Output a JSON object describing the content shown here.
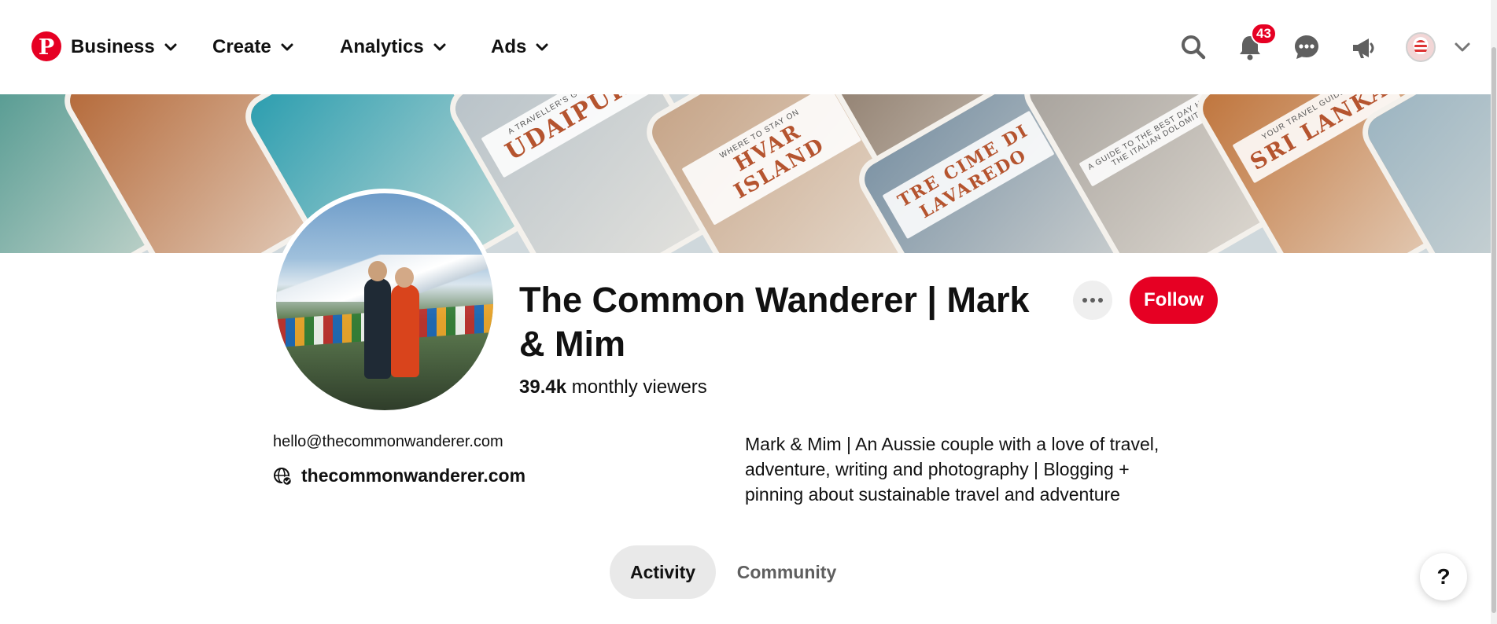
{
  "nav": {
    "logo_letter": "P",
    "business": "Business",
    "create": "Create",
    "analytics": "Analytics",
    "ads": "Ads",
    "notifications_count": "43"
  },
  "cover": {
    "tiles": [
      {
        "caption_small": "",
        "caption_large": "",
        "color": "#3f8f86"
      },
      {
        "caption_small": "",
        "caption_large": "",
        "color": "#b56a3a"
      },
      {
        "caption_small": "",
        "caption_large": "",
        "color": "#2f9fb0"
      },
      {
        "caption_small": "A TRAVELLER'S GUIDE TO",
        "caption_large": "UDAIPUR",
        "color": "#b9c3c9"
      },
      {
        "caption_small": "WHERE TO STAY ON",
        "caption_large": "HVAR ISLAND",
        "color": "#c7a68a"
      },
      {
        "caption_small": "",
        "caption_large": "",
        "color": "#8a7868"
      },
      {
        "caption_small": "",
        "caption_large": "TRE CIME DI LAVAREDO",
        "color": "#7f95a6"
      },
      {
        "caption_small": "A GUIDE TO THE BEST DAY HIKE IN THE ITALIAN DOLOMITES",
        "caption_large": "",
        "color": "#a7a29c"
      },
      {
        "caption_small": "YOUR TRAVEL GUIDE TO",
        "caption_large": "SRI LANKA",
        "color": "#c0763e"
      },
      {
        "caption_small": "",
        "caption_large": "",
        "color": "#9eb6c2"
      }
    ]
  },
  "profile": {
    "name": "The Common Wanderer | Mark & Mim",
    "viewers_count": "39.4k",
    "viewers_label": " monthly viewers",
    "email": "hello@thecommonwanderer.com",
    "website": "thecommonwanderer.com",
    "bio": "Mark & Mim | An Aussie couple with a love of travel, adventure, writing and photography | Blogging + pinning about sustainable travel and adventure",
    "follow_label": "Follow"
  },
  "tabs": {
    "activity": "Activity",
    "community": "Community"
  },
  "help_label": "?",
  "colors": {
    "brand": "#e60023",
    "active_tab_bg": "#e9e9e9"
  }
}
